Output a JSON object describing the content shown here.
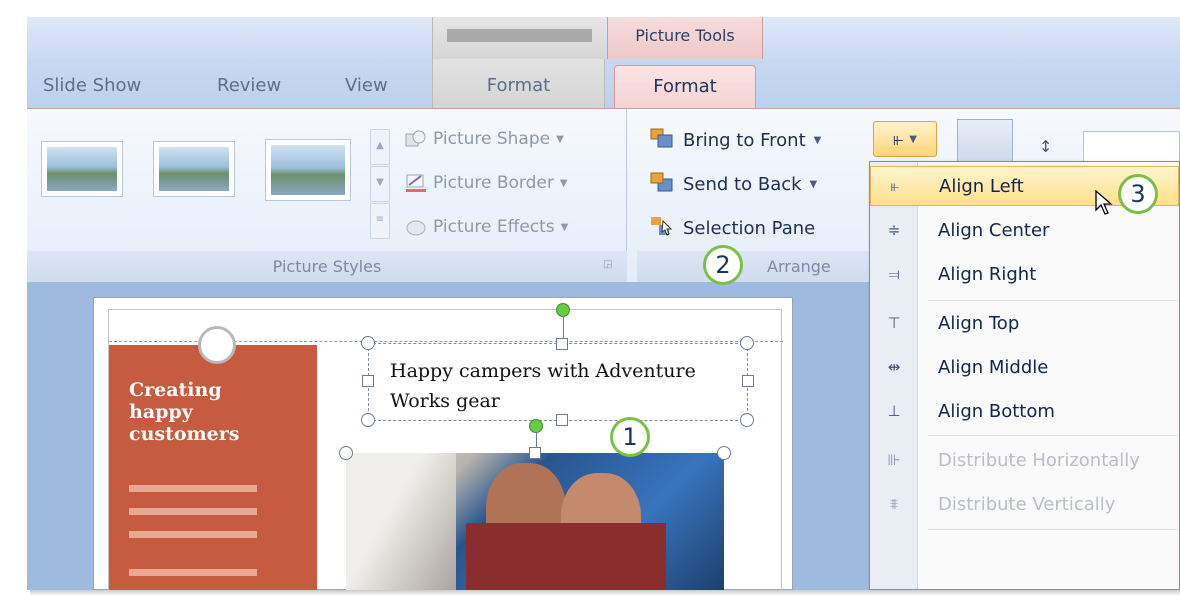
{
  "context_tabs": {
    "gray_label": "",
    "picture_tools": "Picture Tools"
  },
  "tabs": {
    "slide_show": "Slide Show",
    "review": "Review",
    "view": "View",
    "format_inactive": "Format",
    "format_active": "Format"
  },
  "picture_styles": {
    "commands": {
      "shape": "Picture Shape",
      "border": "Picture Border",
      "effects": "Picture Effects"
    },
    "group_label": "Picture Styles"
  },
  "arrange": {
    "commands": {
      "bring_front": "Bring to Front",
      "send_back": "Send to Back",
      "selection_pane": "Selection Pane"
    },
    "group_label": "Arrange"
  },
  "callouts": {
    "one": "1",
    "two": "2",
    "three": "3"
  },
  "slide": {
    "panel_text": [
      "Creating",
      "happy",
      "customers"
    ],
    "textbox_lines": [
      "Happy campers with Adventure",
      "Works gear"
    ]
  },
  "align_menu": {
    "items": [
      {
        "label": "Align Left",
        "icon": "align-left-icon",
        "state": "highlighted"
      },
      {
        "label": "Align Center",
        "icon": "align-center-icon",
        "state": "enabled"
      },
      {
        "label": "Align Right",
        "icon": "align-right-icon",
        "state": "enabled"
      },
      {
        "label": "Align Top",
        "icon": "align-top-icon",
        "state": "enabled"
      },
      {
        "label": "Align Middle",
        "icon": "align-middle-icon",
        "state": "enabled"
      },
      {
        "label": "Align Bottom",
        "icon": "align-bottom-icon",
        "state": "enabled"
      },
      {
        "label": "Distribute Horizontally",
        "icon": "distribute-horizontally-icon",
        "state": "disabled"
      },
      {
        "label": "Distribute Vertically",
        "icon": "distribute-vertically-icon",
        "state": "disabled"
      }
    ]
  },
  "colors": {
    "accent_pink": "#f4d2d2",
    "callout_green": "#7bc043",
    "slide_panel": "#c65b40",
    "menu_highlight": "#ffdf8a"
  }
}
